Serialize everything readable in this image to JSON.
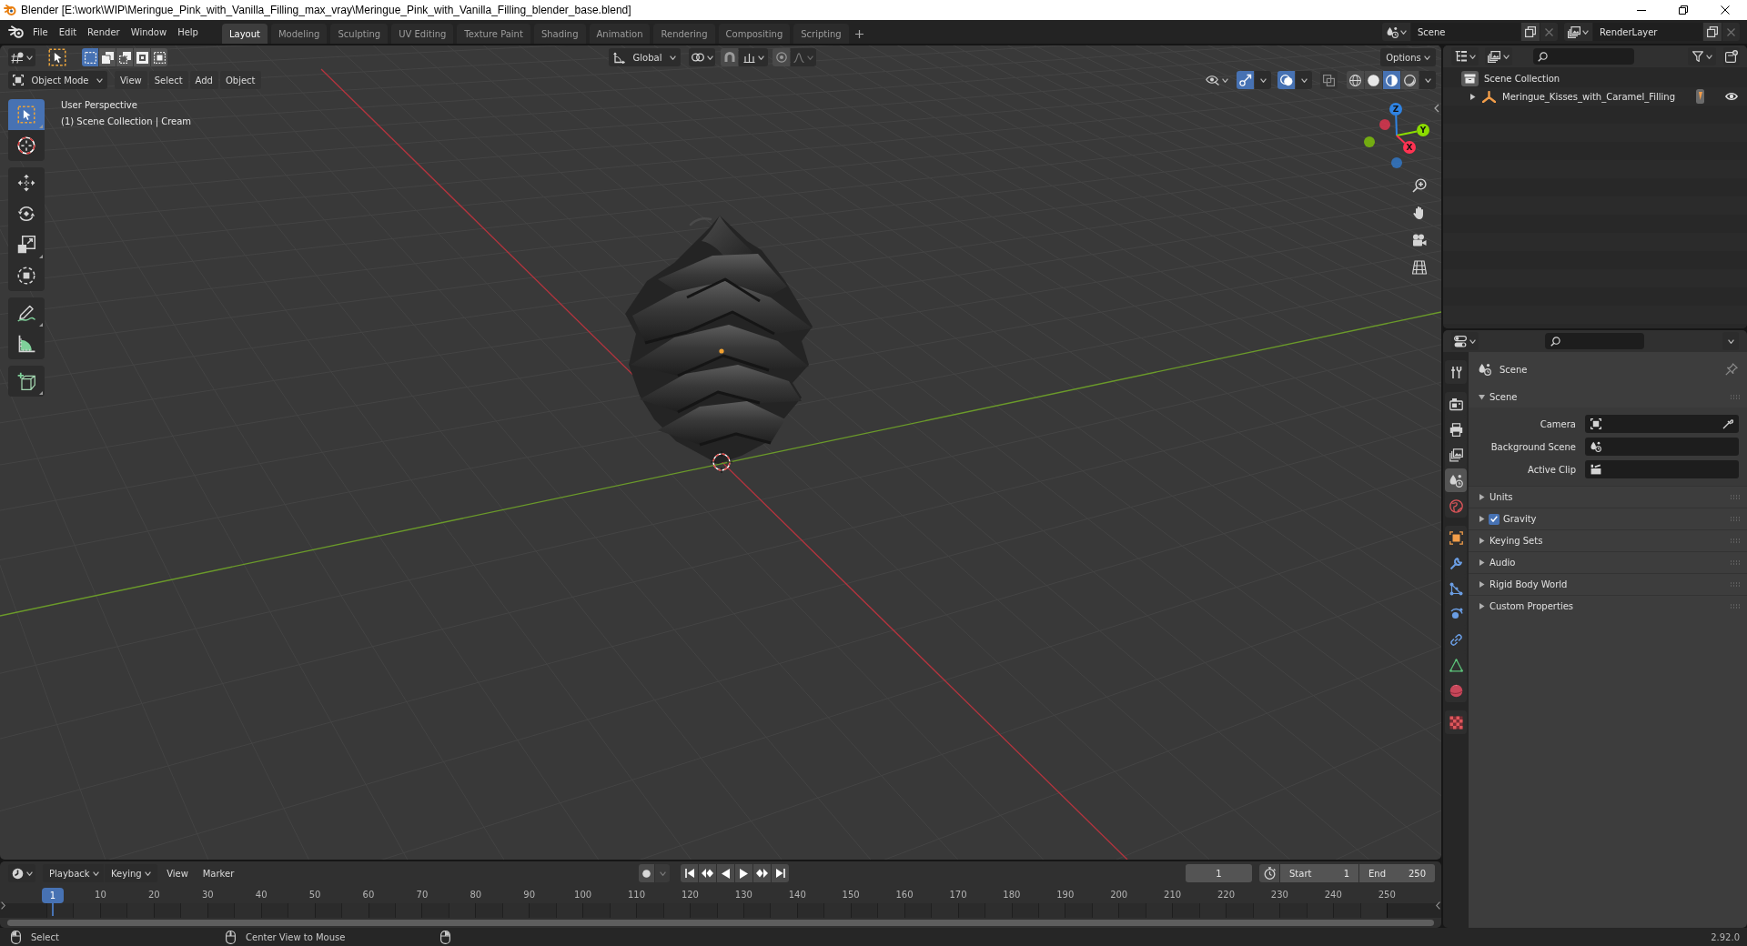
{
  "window": {
    "title": "Blender [E:\\work\\WIP\\Meringue_Pink_with_Vanilla_Filling_max_vray\\Meringue_Pink_with_Vanilla_Filling_blender_base.blend]"
  },
  "menu": [
    "File",
    "Edit",
    "Render",
    "Window",
    "Help"
  ],
  "workspaces": [
    {
      "label": "Layout",
      "selected": true
    },
    {
      "label": "Modeling",
      "selected": false
    },
    {
      "label": "Sculpting",
      "selected": false
    },
    {
      "label": "UV Editing",
      "selected": false
    },
    {
      "label": "Texture Paint",
      "selected": false
    },
    {
      "label": "Shading",
      "selected": false
    },
    {
      "label": "Animation",
      "selected": false
    },
    {
      "label": "Rendering",
      "selected": false
    },
    {
      "label": "Compositing",
      "selected": false
    },
    {
      "label": "Scripting",
      "selected": false
    }
  ],
  "scene_selector": {
    "value": "Scene"
  },
  "view_layer_selector": {
    "value": "RenderLayer"
  },
  "viewport": {
    "select_modes": [
      {
        "kind": "set",
        "selected": true
      },
      {
        "kind": "extend",
        "selected": false
      },
      {
        "kind": "subtract",
        "selected": false
      },
      {
        "kind": "invert",
        "selected": false
      },
      {
        "kind": "intersect",
        "selected": false
      }
    ],
    "orientation": "Global",
    "snap": {
      "on": false
    },
    "proportional": {
      "on": false
    },
    "options": "Options",
    "mode": "Object Mode",
    "menus": [
      "View",
      "Select",
      "Add",
      "Object"
    ],
    "toggles": [
      {
        "kind": "gizmos",
        "on": true
      },
      {
        "kind": "overlays",
        "on": true
      },
      {
        "kind": "xray",
        "on": false
      }
    ],
    "shading": [
      {
        "kind": "wireframe",
        "selected": false
      },
      {
        "kind": "solid",
        "selected": false
      },
      {
        "kind": "material",
        "selected": true
      },
      {
        "kind": "rendered",
        "selected": false
      }
    ],
    "info": [
      "User Perspective",
      "(1) Scene Collection | Cream"
    ],
    "tool_groups": [
      [
        {
          "kind": "select_box",
          "selected": true,
          "submenu": true
        },
        {
          "kind": "cursor",
          "selected": false,
          "submenu": false
        }
      ],
      [
        {
          "kind": "move",
          "selected": false,
          "submenu": false
        },
        {
          "kind": "rotate",
          "selected": false,
          "submenu": false
        },
        {
          "kind": "scale",
          "selected": false,
          "submenu": true
        },
        {
          "kind": "transform",
          "selected": false,
          "submenu": false
        }
      ],
      [
        {
          "kind": "annotate",
          "selected": false,
          "submenu": true
        },
        {
          "kind": "measure",
          "selected": false,
          "submenu": false
        }
      ],
      [
        {
          "kind": "add_cube",
          "selected": false,
          "submenu": true
        }
      ]
    ],
    "gizmo_axes": [
      {
        "label": "Z",
        "color": "#2f83e3"
      },
      {
        "label": "Y",
        "color": "#8bdc00"
      },
      {
        "label": "X",
        "color": "#ff3352"
      }
    ]
  },
  "outliner": {
    "items": [
      {
        "kind": "collection",
        "label": "Scene Collection",
        "children": [
          {
            "kind": "empty",
            "label": "Meringue_Kisses_with_Caramel_Filling",
            "expanded": false,
            "visible": true,
            "inline_children": [
              {
                "kind": "mesh"
              }
            ]
          }
        ]
      }
    ]
  },
  "properties": {
    "tab_groups": [
      [
        {
          "kind": "tool",
          "selected": false
        }
      ],
      [
        {
          "kind": "render",
          "selected": false
        },
        {
          "kind": "output",
          "selected": false
        },
        {
          "kind": "view_layer",
          "selected": false
        },
        {
          "kind": "scene",
          "selected": true
        },
        {
          "kind": "world",
          "selected": false
        }
      ],
      [
        {
          "kind": "object",
          "selected": false
        },
        {
          "kind": "modifiers",
          "selected": false
        },
        {
          "kind": "particles",
          "selected": false
        },
        {
          "kind": "physics",
          "selected": false
        },
        {
          "kind": "constraints",
          "selected": false
        },
        {
          "kind": "data",
          "selected": false
        },
        {
          "kind": "material",
          "selected": false
        }
      ],
      [
        {
          "kind": "texture",
          "selected": false
        }
      ]
    ],
    "context": "Scene",
    "panels": [
      {
        "title": "Scene",
        "expanded": true,
        "fields": [
          {
            "label": "Camera",
            "kind": "camera"
          },
          {
            "label": "Background Scene",
            "kind": "scene"
          },
          {
            "label": "Active Clip",
            "kind": "clip"
          }
        ]
      },
      {
        "title": "Units",
        "expanded": false
      },
      {
        "title": "Gravity",
        "expanded": false,
        "checked": true
      },
      {
        "title": "Keying Sets",
        "expanded": false
      },
      {
        "title": "Audio",
        "expanded": false
      },
      {
        "title": "Rigid Body World",
        "expanded": false
      },
      {
        "title": "Custom Properties",
        "expanded": false
      }
    ]
  },
  "timeline": {
    "menus": [
      {
        "label": "Playback",
        "dropdown": true
      },
      {
        "label": "Keying",
        "dropdown": true
      },
      {
        "label": "View",
        "dropdown": false
      },
      {
        "label": "Marker",
        "dropdown": false
      }
    ],
    "auto_keying": {
      "on": false
    },
    "current_frame": "1",
    "start": {
      "label": "Start",
      "value": "1"
    },
    "end": {
      "label": "End",
      "value": "250"
    },
    "playhead": "1",
    "ticks": [
      "10",
      "20",
      "30",
      "40",
      "50",
      "60",
      "70",
      "80",
      "90",
      "100",
      "110",
      "120",
      "130",
      "140",
      "150",
      "160",
      "170",
      "180",
      "190",
      "200",
      "210",
      "220",
      "230",
      "240",
      "250"
    ]
  },
  "status_bar": {
    "hints": [
      {
        "kind": "left_click",
        "label": "Select"
      },
      {
        "kind": "middle_click",
        "label": "Center View to Mouse"
      },
      {
        "kind": "right_click"
      }
    ],
    "version": "2.92.0"
  }
}
